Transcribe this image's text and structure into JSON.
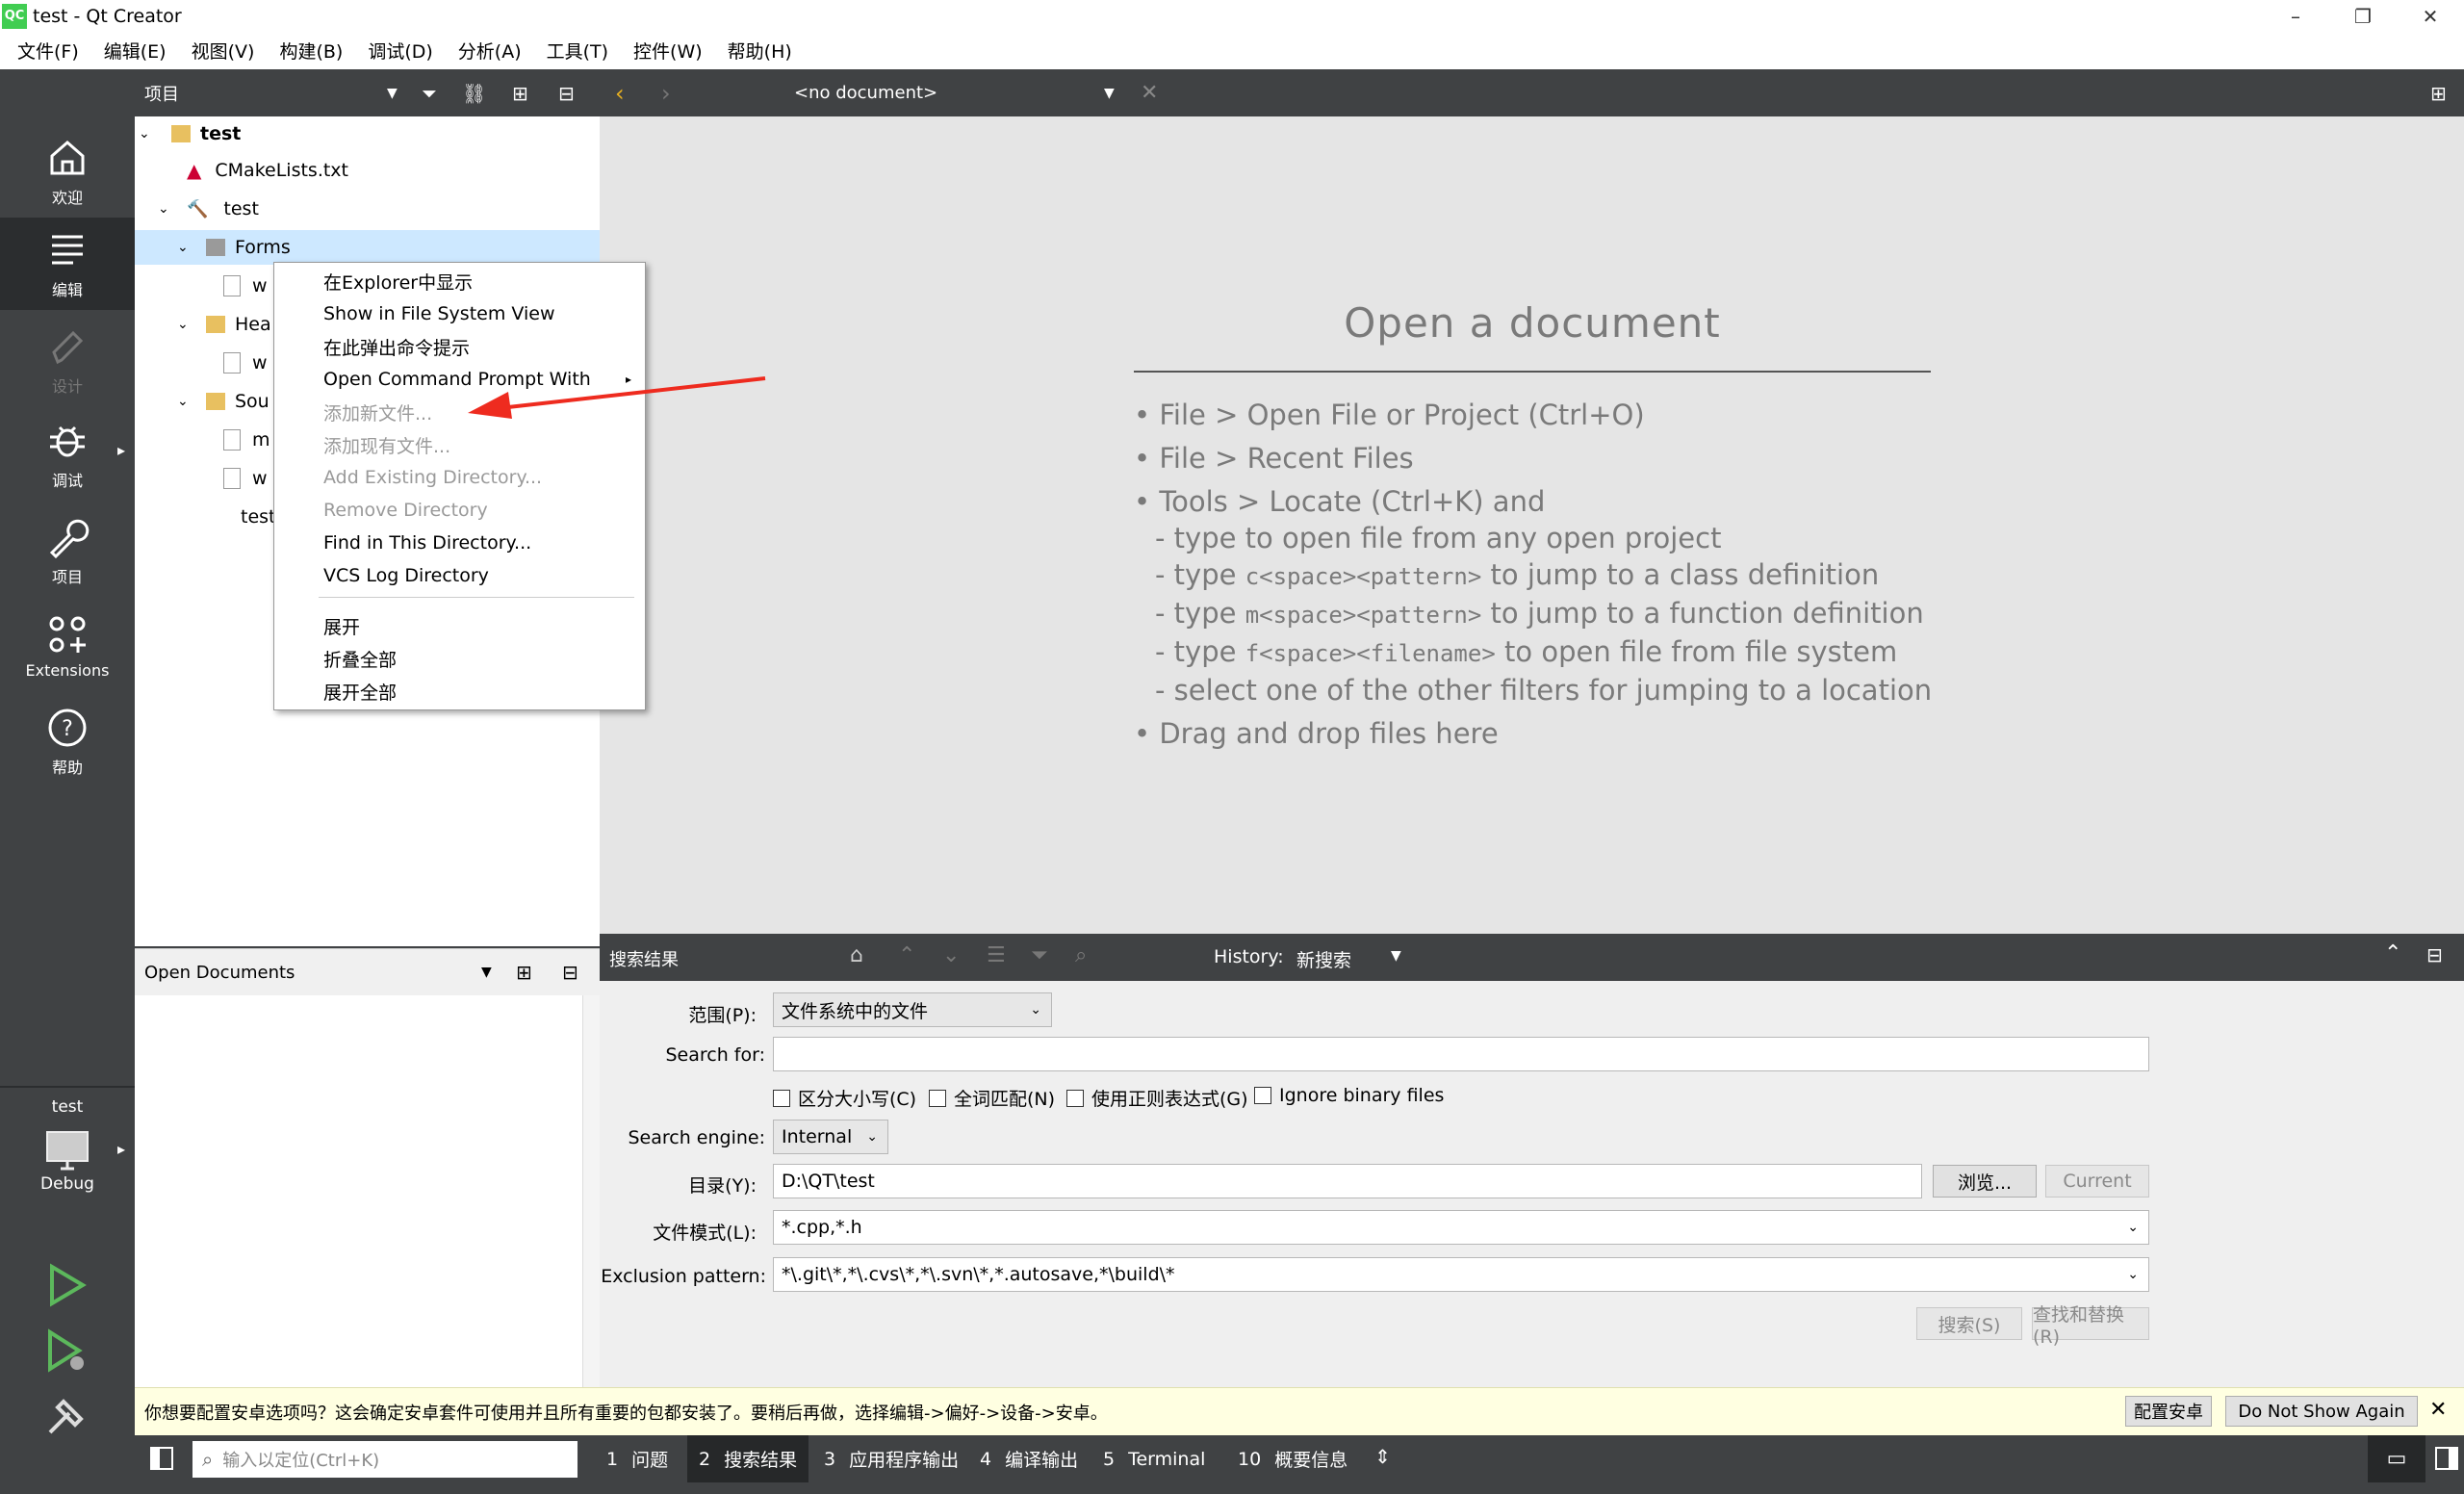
{
  "window": {
    "title": "test - Qt Creator",
    "logo": "QC",
    "minimize": "–",
    "restore": "❐",
    "close": "✕"
  },
  "menu": [
    "文件(F)",
    "编辑(E)",
    "视图(V)",
    "构建(B)",
    "调试(D)",
    "分析(A)",
    "工具(T)",
    "控件(W)",
    "帮助(H)"
  ],
  "modes": [
    {
      "label": "欢迎",
      "icon": "home-icon"
    },
    {
      "label": "编辑",
      "icon": "edit-icon"
    },
    {
      "label": "设计",
      "icon": "pen-icon"
    },
    {
      "label": "调试",
      "icon": "bug-icon"
    },
    {
      "label": "项目",
      "icon": "wrench-icon"
    },
    {
      "label": "Extensions",
      "icon": "extensions-icon"
    },
    {
      "label": "帮助",
      "icon": "help-icon"
    }
  ],
  "kit": {
    "project": "test",
    "config": "Debug"
  },
  "projects": {
    "title": "项目",
    "tree": {
      "root": "test",
      "cmake": "CMakeLists.txt",
      "target": "test",
      "forms": "Forms",
      "forms_child": "w",
      "headers": "Hea",
      "headers_child": "w",
      "sources": "Sou",
      "src_child1": "m",
      "src_child2": "w",
      "test_item": "test"
    }
  },
  "context_menu": {
    "items": [
      {
        "label": "在Explorer中显示",
        "disabled": false
      },
      {
        "label": "Show in File System View",
        "disabled": false
      },
      {
        "label": "在此弹出命令提示",
        "disabled": false
      },
      {
        "label": "Open Command Prompt With",
        "disabled": false,
        "submenu": true
      },
      {
        "label": "添加新文件...",
        "disabled": true
      },
      {
        "label": "添加现有文件...",
        "disabled": true
      },
      {
        "label": "Add Existing Directory...",
        "disabled": true
      },
      {
        "label": "Remove Directory",
        "disabled": true
      },
      {
        "label": "Find in This Directory...",
        "disabled": false
      },
      {
        "label": "VCS Log Directory",
        "disabled": false
      }
    ],
    "items2": [
      {
        "label": "展开"
      },
      {
        "label": "折叠全部"
      },
      {
        "label": "展开全部"
      }
    ]
  },
  "editor": {
    "doc_selector": "<no document>",
    "heading": "Open a document",
    "lines": [
      "• File > Open File or Project (Ctrl+O)",
      "• File > Recent Files",
      "• Tools > Locate (Ctrl+K) and"
    ],
    "sub": {
      "l1": "- type to open file from any open project",
      "l2a": "- type ",
      "l2b": "c<space><pattern>",
      "l2c": " to jump to a class definition",
      "l3a": "- type ",
      "l3b": "m<space><pattern>",
      "l3c": " to jump to a function definition",
      "l4a": "- type ",
      "l4b": "f<space><filename>",
      "l4c": " to open file from file system",
      "l5": "- select one of the other filters for jumping to a location"
    },
    "drag": "• Drag and drop files here"
  },
  "open_documents": {
    "title": "Open Documents"
  },
  "search": {
    "title": "搜索结果",
    "history_label": "History:",
    "history_value": "新搜索",
    "scope_label": "范围(P):",
    "scope_value": "文件系统中的文件",
    "search_for_label": "Search for:",
    "search_for_value": "",
    "opt_case": "区分大小写(C)",
    "opt_whole": "全词匹配(N)",
    "opt_regex": "使用正则表达式(G)",
    "opt_binary": "Ignore binary files",
    "engine_label": "Search engine:",
    "engine_value": "Internal",
    "dir_label": "目录(Y):",
    "dir_value": "D:\\QT\\test",
    "browse": "浏览...",
    "current": "Current",
    "pattern_label": "文件模式(L):",
    "pattern_value": "*.cpp,*.h",
    "exclusion_label": "Exclusion pattern:",
    "exclusion_value": "*\\.git\\*,*\\.cvs\\*,*\\.svn\\*,*.autosave,*\\build\\*",
    "search_btn": "搜索(S)",
    "replace_btn": "查找和替换(R)"
  },
  "infobar": {
    "message": "你想要配置安卓选项吗？这会确定安卓套件可使用并且所有重要的包都安装了。要稍后再做，选择编辑->偏好->设备->安卓。",
    "configure": "配置安卓",
    "dismiss": "Do Not Show Again"
  },
  "statusbar": {
    "locator_placeholder": "输入以定位(Ctrl+K)",
    "tabs": [
      {
        "num": "1",
        "label": "问题"
      },
      {
        "num": "2",
        "label": "搜索结果"
      },
      {
        "num": "3",
        "label": "应用程序输出"
      },
      {
        "num": "4",
        "label": "编译输出"
      },
      {
        "num": "5",
        "label": "Terminal"
      },
      {
        "num": "10",
        "label": "概要信息"
      }
    ]
  }
}
